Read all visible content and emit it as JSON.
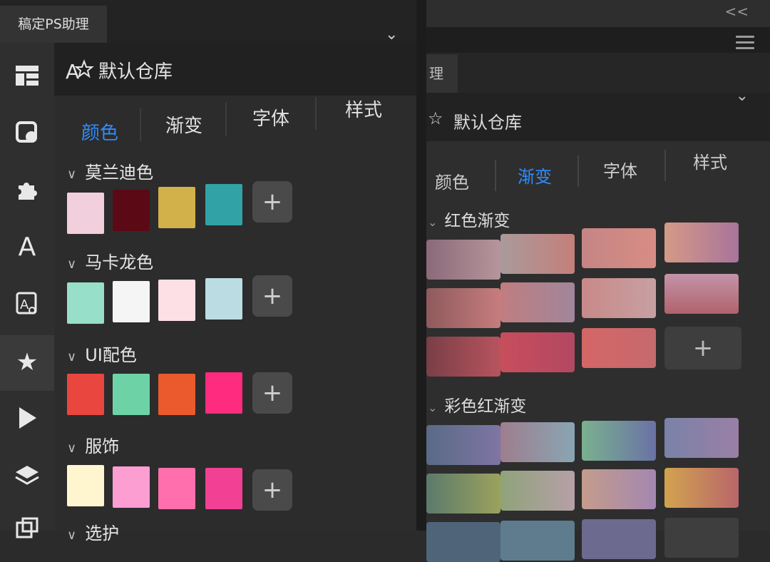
{
  "back_panel": {
    "tab_fragment": "理",
    "collapse": "<<",
    "header_title": "默认仓库",
    "tabs": [
      {
        "label": "颜色",
        "active": false
      },
      {
        "label": "渐变",
        "active": true
      },
      {
        "label": "字体",
        "active": false
      },
      {
        "label": "样式",
        "active": false
      }
    ],
    "sections": [
      {
        "name": "红色渐变"
      },
      {
        "name": "彩色红渐变"
      }
    ],
    "add_label": "+"
  },
  "front_panel": {
    "app_tab": "稿定PS助理",
    "chevron": "⌄",
    "header_title": "默认仓库",
    "tabs": [
      {
        "label": "颜色",
        "active": true
      },
      {
        "label": "渐变",
        "active": false
      },
      {
        "label": "字体",
        "active": false
      },
      {
        "label": "样式",
        "active": false
      }
    ],
    "sidebar_icons": [
      "layout-icon",
      "shapes-icon",
      "puzzle-icon",
      "text-icon",
      "font-search-icon",
      "star-icon",
      "play-icon",
      "layers-icon",
      "export-icon"
    ],
    "sections": [
      {
        "name": "莫兰迪色",
        "colors": [
          "#f2cfdc",
          "#5b0a15",
          "#d2b04a",
          "#31a3a6"
        ]
      },
      {
        "name": "马卡龙色",
        "colors": [
          "#97dfc8",
          "#f5f5f5",
          "#fde0e6",
          "#bcdce3"
        ]
      },
      {
        "name": "UI配色",
        "colors": [
          "#e9463f",
          "#6dd3a7",
          "#ea5a2c",
          "#ff2b7f"
        ]
      },
      {
        "name": "服饰",
        "colors": [
          "#fff6cf",
          "#fd9ed3",
          "#ff6fae",
          "#f24094"
        ]
      },
      {
        "name": "选护"
      }
    ],
    "add_label": "+"
  }
}
